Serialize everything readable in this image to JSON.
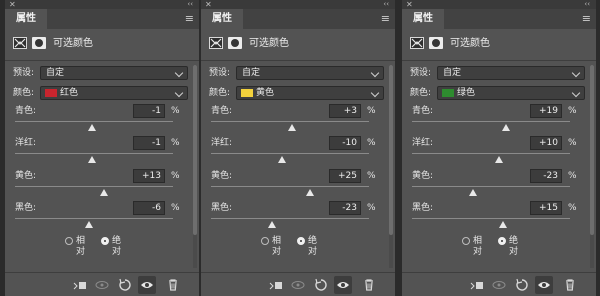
{
  "panels": [
    {
      "tab_title": "属性",
      "adjustment_title": "可选颜色",
      "preset": {
        "label": "预设:",
        "value": "自定"
      },
      "color": {
        "label": "颜色:",
        "value": "红色",
        "swatch": "#c8252e"
      },
      "sliders": [
        {
          "label": "青色:",
          "value": "-1",
          "unit": "%",
          "level": 0.49
        },
        {
          "label": "洋红:",
          "value": "-1",
          "unit": "%",
          "level": 0.49
        },
        {
          "label": "黄色:",
          "value": "+13",
          "unit": "%",
          "level": 0.565
        },
        {
          "label": "黑色:",
          "value": "-6",
          "unit": "%",
          "level": 0.47
        }
      ],
      "modes": [
        {
          "label": "相对",
          "selected": false
        },
        {
          "label": "绝对",
          "selected": true
        }
      ]
    },
    {
      "tab_title": "属性",
      "adjustment_title": "可选颜色",
      "preset": {
        "label": "预设:",
        "value": "自定"
      },
      "color": {
        "label": "颜色:",
        "value": "黄色",
        "swatch": "#f2d13c"
      },
      "sliders": [
        {
          "label": "青色:",
          "value": "+3",
          "unit": "%",
          "level": 0.515
        },
        {
          "label": "洋红:",
          "value": "-10",
          "unit": "%",
          "level": 0.45
        },
        {
          "label": "黄色:",
          "value": "+25",
          "unit": "%",
          "level": 0.625
        },
        {
          "label": "黑色:",
          "value": "-23",
          "unit": "%",
          "level": 0.385
        }
      ],
      "modes": [
        {
          "label": "相对",
          "selected": false
        },
        {
          "label": "绝对",
          "selected": true
        }
      ]
    },
    {
      "tab_title": "属性",
      "adjustment_title": "可选颜色",
      "preset": {
        "label": "预设:",
        "value": "自定"
      },
      "color": {
        "label": "颜色:",
        "value": "绿色",
        "swatch": "#2e8b2f"
      },
      "sliders": [
        {
          "label": "青色:",
          "value": "+19",
          "unit": "%",
          "level": 0.595
        },
        {
          "label": "洋红:",
          "value": "+10",
          "unit": "%",
          "level": 0.55
        },
        {
          "label": "黄色:",
          "value": "-23",
          "unit": "%",
          "level": 0.385
        },
        {
          "label": "黑色:",
          "value": "+15",
          "unit": "%",
          "level": 0.575
        }
      ],
      "modes": [
        {
          "label": "相对",
          "selected": false
        },
        {
          "label": "绝对",
          "selected": true
        }
      ]
    }
  ],
  "icons": {
    "close": "close-icon",
    "collapse": "collapse-double-chevron-icon",
    "menu": "panel-menu-icon",
    "footer": [
      "clip-to-layer-icon",
      "view-previous-state-icon",
      "reset-icon",
      "visibility-eye-icon",
      "delete-trash-icon"
    ]
  }
}
